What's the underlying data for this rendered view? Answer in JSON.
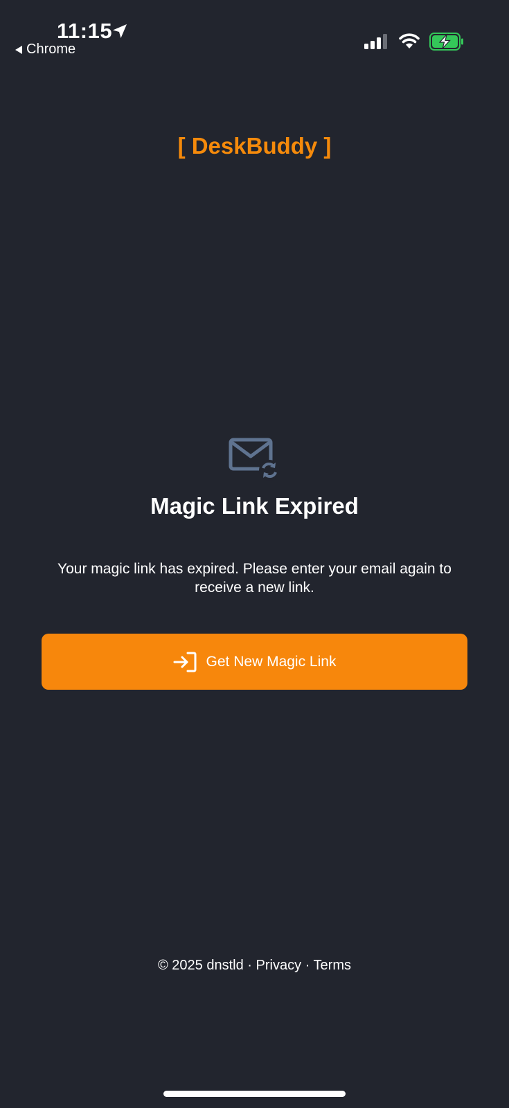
{
  "status_bar": {
    "time": "11:15",
    "back_app": "Chrome",
    "icons": [
      "location-arrow-icon",
      "cellular-signal-icon",
      "wifi-icon",
      "battery-charging-icon"
    ],
    "battery_color": "#34c759"
  },
  "header": {
    "brand": "[ DeskBuddy ]",
    "brand_color": "#f58a0b"
  },
  "main": {
    "icon": "mail-refresh-icon",
    "icon_color": "#5f7390",
    "title": "Magic Link Expired",
    "message": "Your magic link has expired. Please enter your email again to receive a new link.",
    "button": {
      "label": "Get New Magic Link",
      "icon": "sign-in-icon",
      "color": "#f7870c"
    }
  },
  "footer": {
    "copyright": "© 2025 dnstld",
    "separator": "·",
    "privacy": "Privacy",
    "terms": "Terms"
  },
  "background_color": "#22252e"
}
